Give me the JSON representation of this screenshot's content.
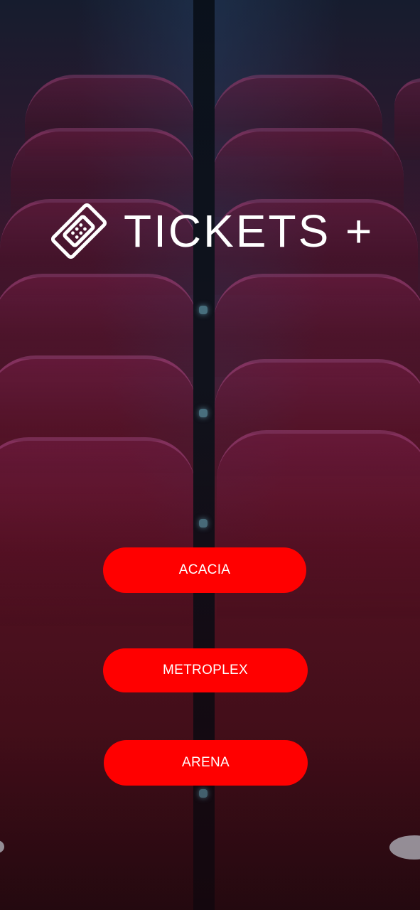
{
  "app": {
    "title": "TICKETS +",
    "logo_icon": "ticket-icon"
  },
  "venues": [
    {
      "label": "ACACIA"
    },
    {
      "label": "METROPLEX"
    },
    {
      "label": "ARENA"
    }
  ],
  "colors": {
    "button": "#ff0000",
    "text": "#ffffff",
    "background": "#4a0f1c"
  },
  "background_image": "cinema-seats"
}
